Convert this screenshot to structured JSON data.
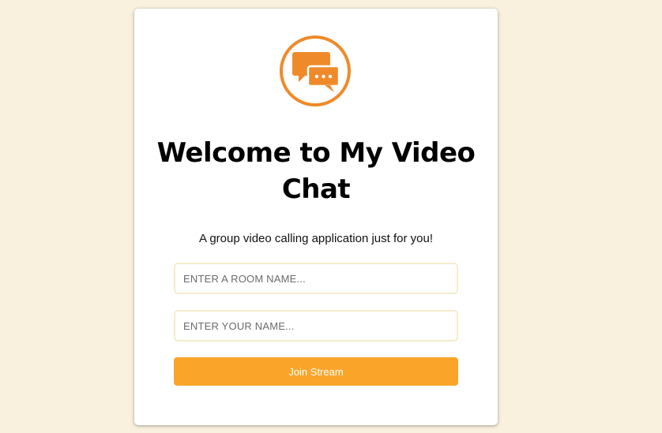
{
  "card": {
    "title_line1": "Welcome to My Video",
    "title_line2": "Chat",
    "subtitle": "A group video calling application just for you!",
    "logo_icon": "chat-bubbles-icon"
  },
  "form": {
    "room_placeholder": "ENTER A ROOM NAME...",
    "room_value": "",
    "name_placeholder": "ENTER YOUR NAME...",
    "name_value": "",
    "submit_label": "Join Stream"
  },
  "colors": {
    "background": "#f9f1de",
    "accent_orange": "#ef8a2a",
    "button": "#faa52a",
    "input_border": "#f4eccd"
  }
}
